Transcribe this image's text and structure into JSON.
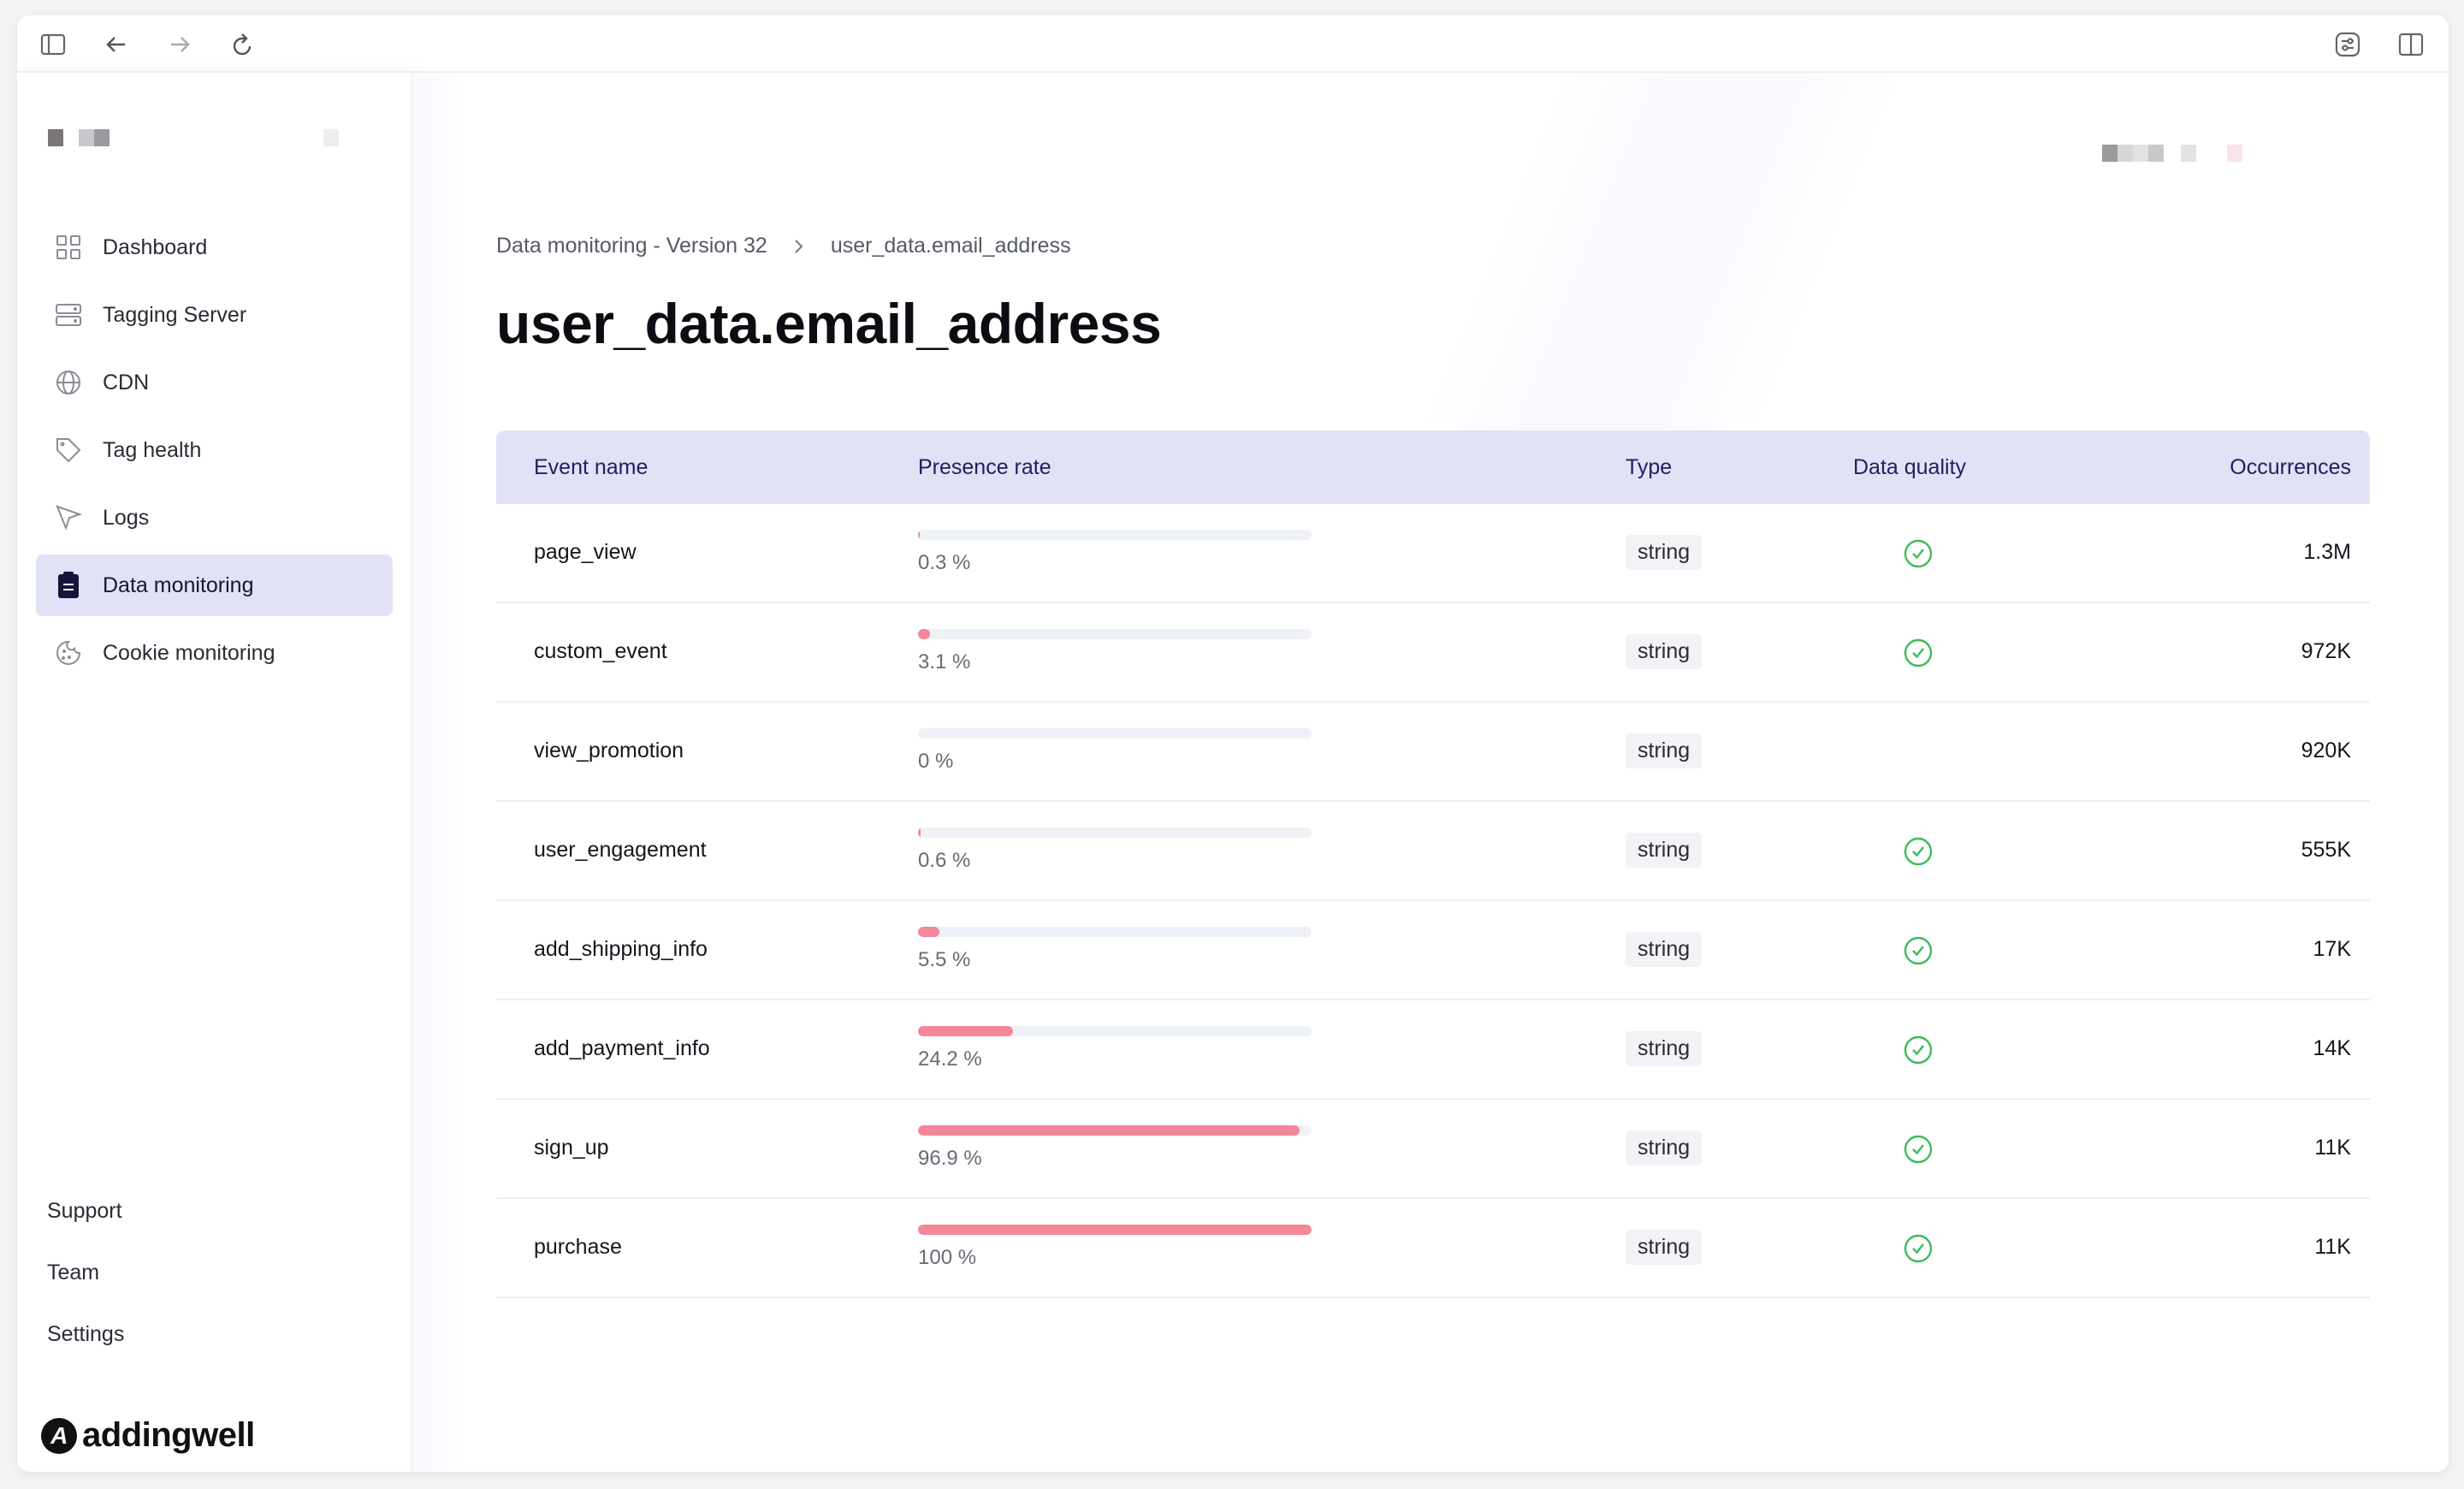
{
  "browser": {
    "icons": [
      "sidebar-toggle-icon",
      "back-arrow-icon",
      "forward-arrow-icon",
      "reload-icon",
      "settings-sliders-icon",
      "split-view-icon"
    ]
  },
  "sidebar": {
    "items": [
      {
        "label": "Dashboard",
        "icon": "grid-icon"
      },
      {
        "label": "Tagging Server",
        "icon": "server-icon"
      },
      {
        "label": "CDN",
        "icon": "globe-icon"
      },
      {
        "label": "Tag health",
        "icon": "tag-icon"
      },
      {
        "label": "Logs",
        "icon": "cursor-icon"
      },
      {
        "label": "Data monitoring",
        "icon": "clipboard-icon",
        "active": true
      },
      {
        "label": "Cookie monitoring",
        "icon": "cookie-icon"
      }
    ],
    "bottom": [
      "Support",
      "Team",
      "Settings"
    ],
    "logo": "addingwell"
  },
  "breadcrumb": [
    "Data monitoring - Version 32",
    "user_data.email_address"
  ],
  "page_title": "user_data.email_address",
  "table": {
    "headers": [
      "Event name",
      "Presence rate",
      "Type",
      "Data quality",
      "Occurrences"
    ],
    "rows": [
      {
        "event": "page_view",
        "rate": 0.3,
        "rate_label": "0.3 %",
        "type": "string",
        "quality_ok": true,
        "occ": "1.3M"
      },
      {
        "event": "custom_event",
        "rate": 3.1,
        "rate_label": "3.1 %",
        "type": "string",
        "quality_ok": true,
        "occ": "972K"
      },
      {
        "event": "view_promotion",
        "rate": 0,
        "rate_label": "0 %",
        "type": "string",
        "quality_ok": false,
        "occ": "920K"
      },
      {
        "event": "user_engagement",
        "rate": 0.6,
        "rate_label": "0.6 %",
        "type": "string",
        "quality_ok": true,
        "occ": "555K"
      },
      {
        "event": "add_shipping_info",
        "rate": 5.5,
        "rate_label": "5.5 %",
        "type": "string",
        "quality_ok": true,
        "occ": "17K"
      },
      {
        "event": "add_payment_info",
        "rate": 24.2,
        "rate_label": "24.2 %",
        "type": "string",
        "quality_ok": true,
        "occ": "14K"
      },
      {
        "event": "sign_up",
        "rate": 96.9,
        "rate_label": "96.9 %",
        "type": "string",
        "quality_ok": true,
        "occ": "11K"
      },
      {
        "event": "purchase",
        "rate": 100,
        "rate_label": "100 %",
        "type": "string",
        "quality_ok": true,
        "occ": "11K"
      }
    ]
  },
  "colors": {
    "accent": "#e2e2f7",
    "bar_fill": "#f4879a",
    "bar_track": "#eef1f5",
    "check": "#3dbb5a",
    "header_text": "#1f2060"
  }
}
